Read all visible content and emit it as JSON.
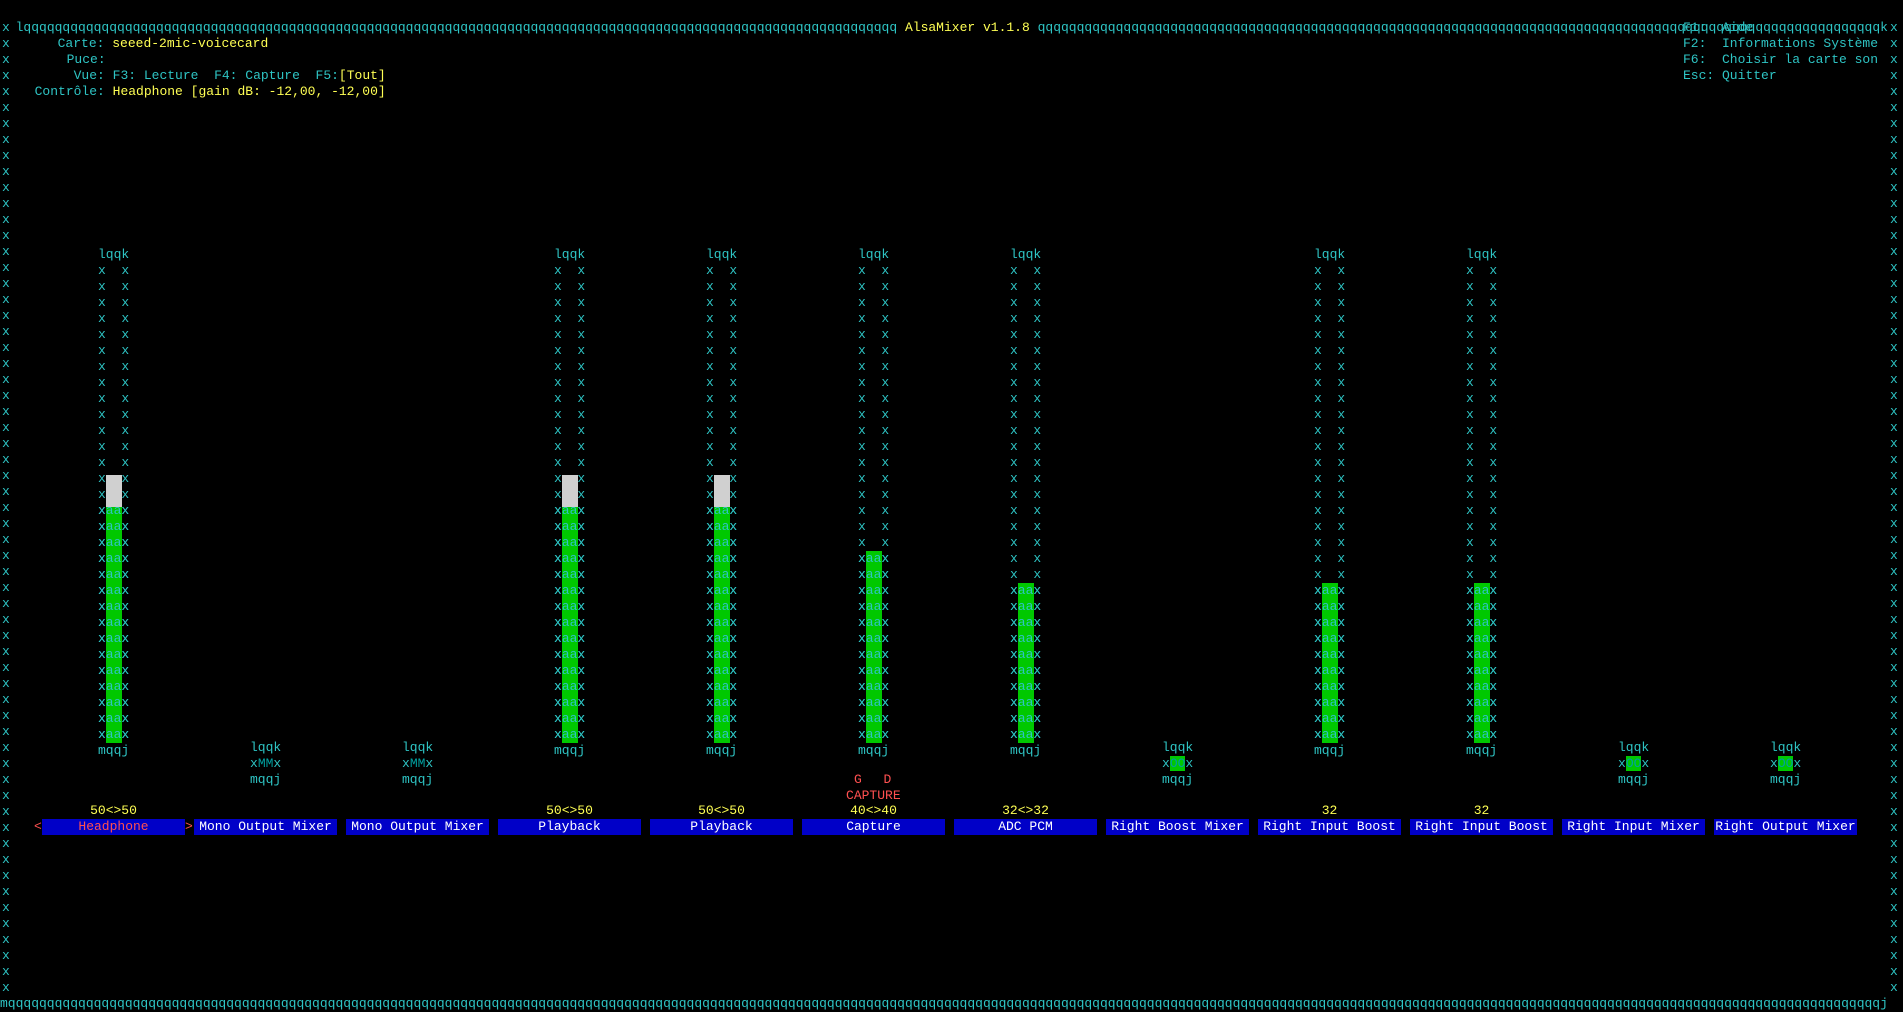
{
  "title": "AlsaMixer v1.1.8",
  "header": {
    "card_label": "Carte:",
    "card_value": "seeed-2mic-voicecard",
    "chip_label": "Puce:",
    "chip_value": "",
    "view_label": "Vue:",
    "view_f3": "F3: Lecture",
    "view_f4": "F4: Capture",
    "view_f5": "F5:",
    "view_f5_value": "[Tout]",
    "control_label": "Contrôle:",
    "control_value": "Headphone [gain dB: -12,00, -12,00]"
  },
  "help": {
    "f1": "F1:  Aide",
    "f2": "F2:  Informations Système",
    "f6": "F6:  Choisir la carte son",
    "esc": "Esc: Quitter"
  },
  "frame_glyphs": {
    "top": "lqqk",
    "bottom": "mqqj",
    "side": "x  x",
    "fill": "xaax",
    "switch_mute": "xMMx",
    "switch_on": "xOOx",
    "switch_middle_mute": "MM",
    "switch_middle_on": "OO",
    "x": "x",
    "selector_left": "<",
    "selector_right": ">"
  },
  "capture_flags": {
    "left": "G",
    "right": "D",
    "label": "CAPTURE"
  },
  "controls": [
    {
      "name": "Headphone",
      "value": "50<>50",
      "level": 0.5,
      "type": "bar",
      "selected": true
    },
    {
      "name": "Mono Output Mixer",
      "value": "",
      "type": "switch",
      "state": "mute"
    },
    {
      "name": "Mono Output Mixer",
      "value": "",
      "type": "switch",
      "state": "mute"
    },
    {
      "name": "Playback",
      "value": "50<>50",
      "level": 0.5,
      "type": "bar"
    },
    {
      "name": "Playback",
      "value": "50<>50",
      "level": 0.5,
      "type": "bar"
    },
    {
      "name": "Capture",
      "value": "40<>40",
      "level": 0.4,
      "type": "bar",
      "capture": true
    },
    {
      "name": "ADC PCM",
      "value": "32<>32",
      "level": 0.32,
      "type": "bar"
    },
    {
      "name": "Right Boost Mixer",
      "value": "",
      "type": "switch",
      "state": "on"
    },
    {
      "name": "Right Input Boost",
      "value": "32",
      "level": 0.32,
      "type": "bar"
    },
    {
      "name": "Right Input Boost",
      "value": "32",
      "level": 0.32,
      "type": "bar"
    },
    {
      "name": "Right Input Mixer",
      "value": "",
      "type": "switch",
      "state": "on"
    },
    {
      "name": "Right Output Mixer",
      "value": "",
      "type": "switch",
      "state": "on"
    }
  ],
  "colors": {
    "border": "#2ec4c4",
    "highlight": "#ffff54",
    "bar_fill": "#00c800",
    "bar_peak": "#d0d0d0",
    "name_bg": "#0000c8",
    "selected_text": "#ff5050"
  }
}
